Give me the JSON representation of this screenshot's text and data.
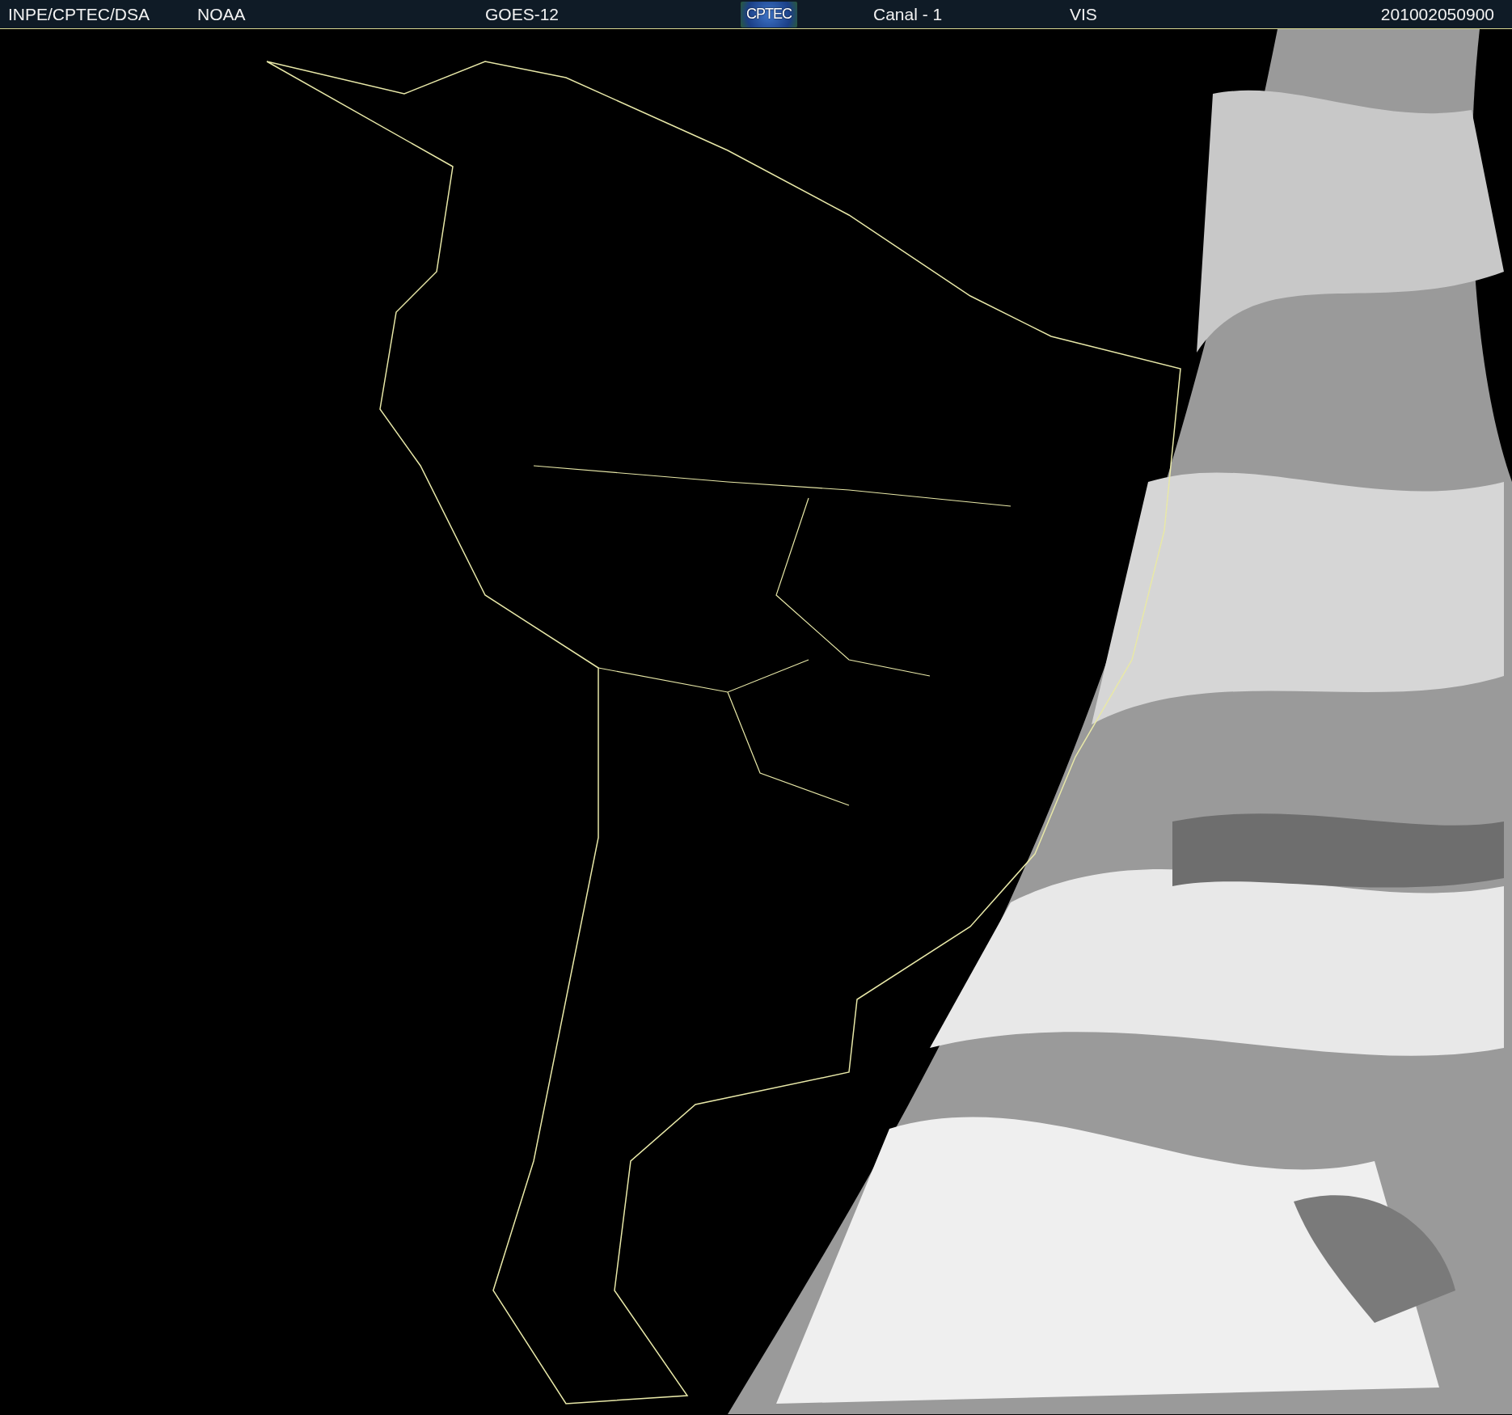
{
  "header": {
    "items": [
      {
        "kind": "text",
        "text": "INPE/CPTEC/DSA"
      },
      {
        "kind": "text",
        "text": "NOAA"
      },
      {
        "kind": "text",
        "text": "GOES-12"
      },
      {
        "kind": "logo",
        "text": "CPTEC"
      },
      {
        "kind": "text",
        "text": "Canal - 1"
      },
      {
        "kind": "text",
        "text": "VIS"
      },
      {
        "kind": "text",
        "text": "201002050900"
      }
    ]
  }
}
